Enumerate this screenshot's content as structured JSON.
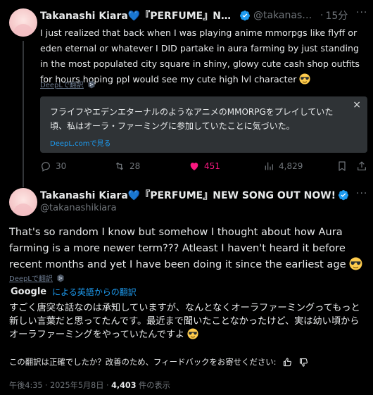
{
  "tweet1": {
    "name": "Takanashi Kiara💙『PERFUME』NEW SONG ...",
    "handle": "@takanashi...",
    "dot": "·",
    "time": "15分",
    "more": "···",
    "body": "I just realized that back when I was playing anime mmorpgs like flyff or eden eternal or whatever I DID partake in aura farming by just standing in the most populated city square in shiny, glowy cute cash shop outfits for hours hoping ppl would see my cute high lvl character",
    "deepl_label": "DeepLで翻訳",
    "translation_card": {
      "text": "フライフやエデンエターナルのようなアニメのMMORPGをプレイしていた頃、私はオーラ・ファーミングに参加していたことに気づいた。",
      "link": "DeepL.comで見る",
      "close": "×"
    },
    "actions": {
      "replies": "30",
      "reposts": "28",
      "likes": "451",
      "views": "4,829"
    }
  },
  "tweet2": {
    "name": "Takanashi Kiara💙『PERFUME』NEW SONG OUT NOW!",
    "handle": "@takanashikiara",
    "more": "···",
    "body": "That's so random I know but somehow I thought about how Aura farming is a more newer term??? Atleast I haven't heard it before recent months and yet I have been doing it since the earliest age",
    "deepl_label": "DeepLで翻訳",
    "google_logo": "Google",
    "google_link": "による英語からの翻訳",
    "translation": "すごく唐突な話なのは承知していますが、なんとなくオーラファーミングってもっと新しい言葉だと思ってたんです。最近まで聞いたことなかったけど、実は幼い頃からオーラファーミングをやっていたんですよ",
    "feedback": "この翻訳は正確でしたか？改善のため、フィードバックをお寄せください:",
    "meta_time": "午後4:35 · 2025年5月8日 · ",
    "meta_views": "4,403",
    "meta_views_suffix": " 件の表示"
  },
  "colors": {
    "background": "#000000",
    "text": "#e7e9ea",
    "muted": "#71767b",
    "link": "#1d9bf0",
    "like": "#f91880",
    "card": "#2f3336",
    "verified": "#1d9bf0"
  }
}
